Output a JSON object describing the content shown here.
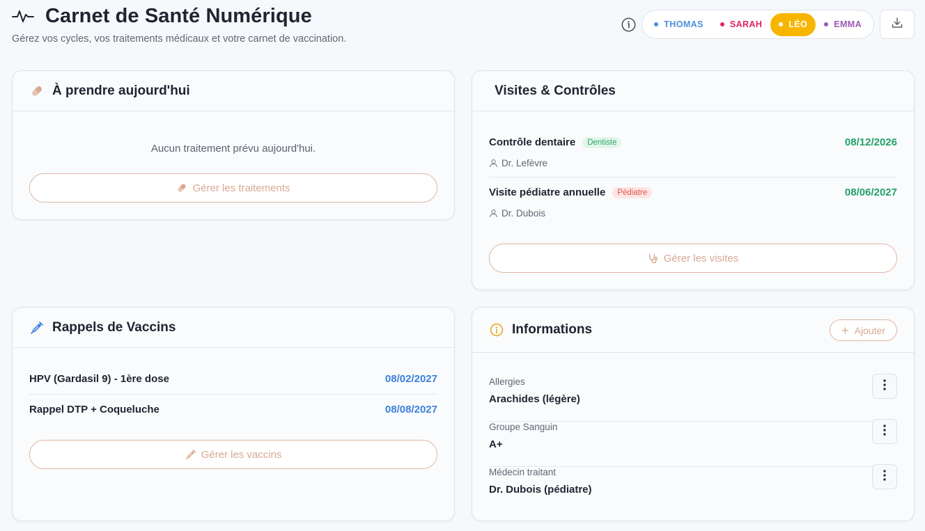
{
  "header": {
    "title": "Carnet de Santé Numérique",
    "subtitle": "Gérez vos cycles, vos traitements médicaux et votre carnet de vaccination."
  },
  "profiles": [
    {
      "label": "THOMAS",
      "color": "#4a8fe0",
      "active": false
    },
    {
      "label": "SARAH",
      "color": "#e0245e",
      "active": false
    },
    {
      "label": "LÉO",
      "color": "#ffffff",
      "active": true
    },
    {
      "label": "EMMA",
      "color": "#9b59b6",
      "active": false
    }
  ],
  "colors": {
    "accent": "#f7b500",
    "button_border": "#e2b5a2",
    "button_text": "#d9a893",
    "visit_date": "#23a06b",
    "vaccine_date": "#3d7fdc"
  },
  "today": {
    "title": "À prendre aujourd'hui",
    "empty": "Aucun traitement prévu aujourd'hui.",
    "button": "Gérer les traitements"
  },
  "visits": {
    "title": "Visites & Contrôles",
    "items": [
      {
        "name": "Contrôle dentaire",
        "badge": "Dentiste",
        "doctor": "Dr. Lefèvre",
        "date": "08/12/2026"
      },
      {
        "name": "Visite pédiatre annuelle",
        "badge": "Pédiatre",
        "doctor": "Dr. Dubois",
        "date": "08/06/2027"
      }
    ],
    "button": "Gérer les visites"
  },
  "vaccines": {
    "title": "Rappels de Vaccins",
    "items": [
      {
        "name": "HPV (Gardasil 9) - 1ère dose",
        "date": "08/02/2027"
      },
      {
        "name": "Rappel DTP + Coqueluche",
        "date": "08/08/2027"
      }
    ],
    "button": "Gérer les vaccins"
  },
  "info": {
    "title": "Informations",
    "add_button": "Ajouter",
    "items": [
      {
        "label": "Allergies",
        "value": "Arachides (légère)"
      },
      {
        "label": "Groupe Sanguin",
        "value": "A+"
      },
      {
        "label": "Médecin traitant",
        "value": "Dr. Dubois (pédiatre)"
      }
    ]
  },
  "icons": {
    "header": "pulse-icon",
    "info": "info-icon",
    "export": "download-icon",
    "today": "pill-icon",
    "visits_button": "stethoscope-icon",
    "vaccines": "syringe-icon",
    "info_card": "info-circle-icon",
    "person": "person-icon",
    "more": "kebab-icon"
  }
}
